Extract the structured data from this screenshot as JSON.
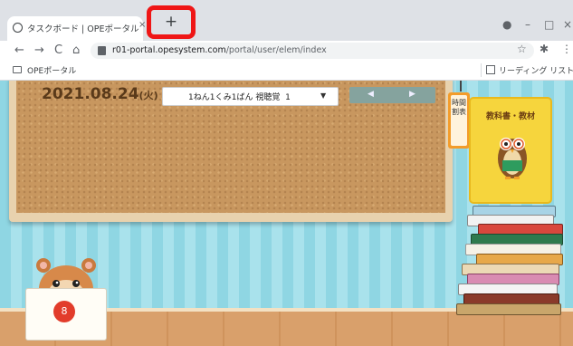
{
  "browser": {
    "tab": {
      "title": "タスクボード | OPEポータル",
      "close_glyph": "×"
    },
    "new_tab_glyph": "+",
    "window_controls": {
      "account_glyph": "●",
      "minimize": "–",
      "maximize": "□",
      "close": "×"
    },
    "nav": {
      "back": "←",
      "forward": "→",
      "reload": "C",
      "home": "⌂"
    },
    "url": {
      "host": "r01-portal.opesystem.com",
      "path": "/portal/user/elem/index"
    },
    "extensions": {
      "star": "☆",
      "puzzle": "✱",
      "menu": "⋮"
    },
    "bookmarks": {
      "item": "OPEポータル",
      "reading_list": "リーディング リスト"
    }
  },
  "board": {
    "date": "2021.08.24",
    "weekday": "(火)",
    "class_select_value": "1ねん1くみ1ばん 視聴覚",
    "class_select_number": "1",
    "class_select_arrow": "▼",
    "prev": "◀",
    "next": "▶",
    "timetable_tag": "時間割表",
    "textbook_label": "教科書・教材",
    "envelope_count": "8"
  },
  "colors": {
    "highlight": "#ef1616",
    "cork": "#c8975f",
    "wall": "#8fd6e3"
  }
}
